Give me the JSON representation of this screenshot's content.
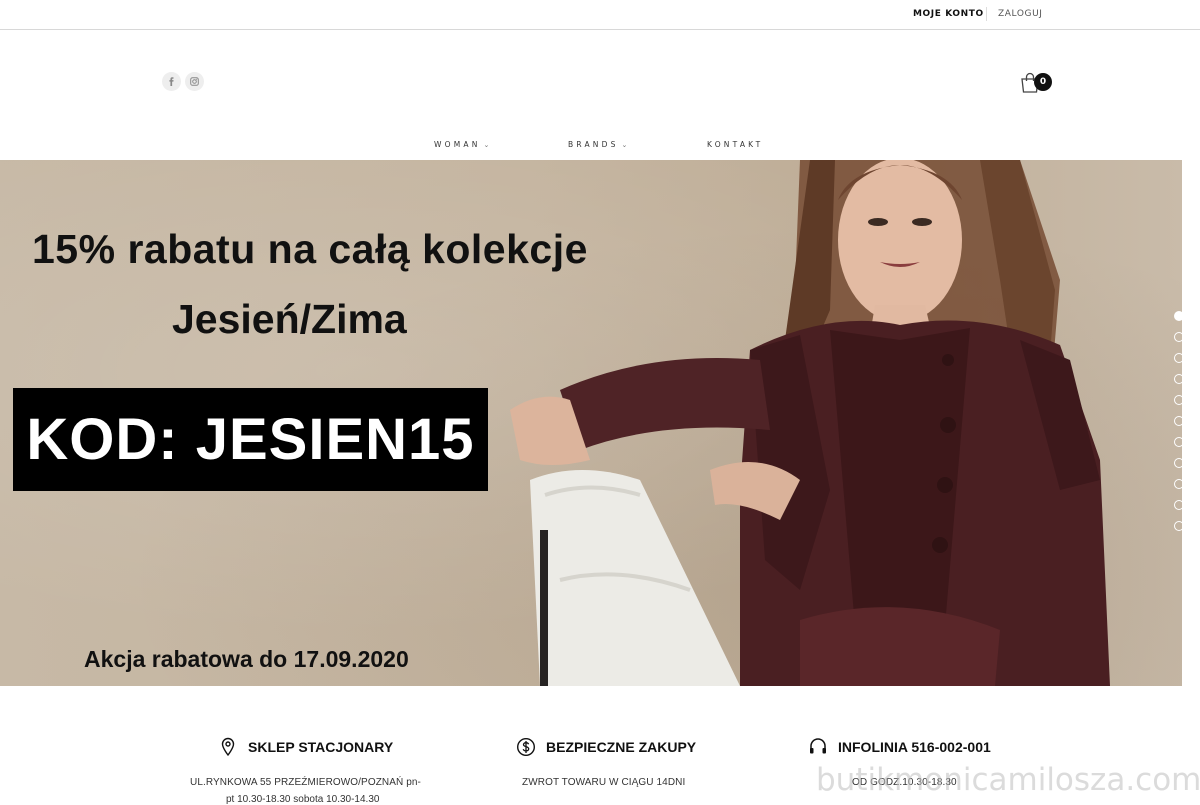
{
  "topbar": {
    "my_account": "MOJE KONTO",
    "login": "ZALOGUJ"
  },
  "social": {
    "facebook": "facebook-icon",
    "instagram": "instagram-icon"
  },
  "cart": {
    "count": "0"
  },
  "nav": {
    "items": [
      {
        "label": "WOMAN",
        "chevron": "⌄"
      },
      {
        "label": "BRANDS",
        "chevron": "⌄"
      },
      {
        "label": "KONTAKT"
      }
    ]
  },
  "hero": {
    "headline": "15% rabatu na całą kolekcje",
    "season": "Jesień/Zima",
    "code": "KOD: JESIEN15",
    "until": "Akcja rabatowa do 17.09.2020",
    "slides_total": 11,
    "active_slide": 1
  },
  "features": [
    {
      "icon": "map-pin-icon",
      "title": "SKLEP STACJONARY",
      "desc": "UL.RYNKOWA 55 PRZEŹMIEROWO/POZNAŃ    pn-",
      "desc2": "pt 10.30-18.30 sobota 10.30-14.30"
    },
    {
      "icon": "dollar-coin-icon",
      "title": "BEZPIECZNE ZAKUPY",
      "desc": "ZWROT TOWARU W CIĄGU 14DNI"
    },
    {
      "icon": "headset-icon",
      "title": "INFOLINIA 516-002-001",
      "desc": "OD GODZ.10.30-18.30"
    }
  ],
  "watermark": "butikmonicamilosza.com.pl"
}
